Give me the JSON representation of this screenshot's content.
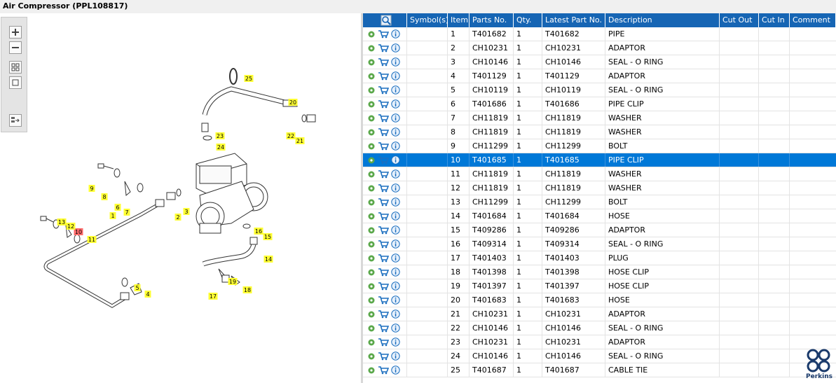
{
  "window": {
    "title": "Air Compressor (PPL108817)"
  },
  "toolbar": {
    "zoom_in_icon": "plus-icon",
    "zoom_out_icon": "minus-icon",
    "fit_icon": "grid-icon",
    "actual_icon": "square-icon",
    "export_icon": "list-arrow-icon"
  },
  "table": {
    "columns": [
      "",
      "Symbol(s)",
      "Item",
      "Parts No.",
      "Qty.",
      "Latest Part No.",
      "Description",
      "Cut Out",
      "Cut In",
      "Comment"
    ],
    "selected_item": "10",
    "rows": [
      {
        "item": "1",
        "part": "T401682",
        "qty": "1",
        "latest": "T401682",
        "desc": "PIPE"
      },
      {
        "item": "2",
        "part": "CH10231",
        "qty": "1",
        "latest": "CH10231",
        "desc": "ADAPTOR"
      },
      {
        "item": "3",
        "part": "CH10146",
        "qty": "1",
        "latest": "CH10146",
        "desc": "SEAL - O RING"
      },
      {
        "item": "4",
        "part": "T401129",
        "qty": "1",
        "latest": "T401129",
        "desc": "ADAPTOR"
      },
      {
        "item": "5",
        "part": "CH10119",
        "qty": "1",
        "latest": "CH10119",
        "desc": "SEAL - O RING"
      },
      {
        "item": "6",
        "part": "T401686",
        "qty": "1",
        "latest": "T401686",
        "desc": "PIPE CLIP"
      },
      {
        "item": "7",
        "part": "CH11819",
        "qty": "1",
        "latest": "CH11819",
        "desc": "WASHER"
      },
      {
        "item": "8",
        "part": "CH11819",
        "qty": "1",
        "latest": "CH11819",
        "desc": "WASHER"
      },
      {
        "item": "9",
        "part": "CH11299",
        "qty": "1",
        "latest": "CH11299",
        "desc": "BOLT"
      },
      {
        "item": "10",
        "part": "T401685",
        "qty": "1",
        "latest": "T401685",
        "desc": "PIPE CLIP"
      },
      {
        "item": "11",
        "part": "CH11819",
        "qty": "1",
        "latest": "CH11819",
        "desc": "WASHER"
      },
      {
        "item": "12",
        "part": "CH11819",
        "qty": "1",
        "latest": "CH11819",
        "desc": "WASHER"
      },
      {
        "item": "13",
        "part": "CH11299",
        "qty": "1",
        "latest": "CH11299",
        "desc": "BOLT"
      },
      {
        "item": "14",
        "part": "T401684",
        "qty": "1",
        "latest": "T401684",
        "desc": "HOSE"
      },
      {
        "item": "15",
        "part": "T409286",
        "qty": "1",
        "latest": "T409286",
        "desc": "ADAPTOR"
      },
      {
        "item": "16",
        "part": "T409314",
        "qty": "1",
        "latest": "T409314",
        "desc": "SEAL - O RING"
      },
      {
        "item": "17",
        "part": "T401403",
        "qty": "1",
        "latest": "T401403",
        "desc": "PLUG"
      },
      {
        "item": "18",
        "part": "T401398",
        "qty": "1",
        "latest": "T401398",
        "desc": "HOSE CLIP"
      },
      {
        "item": "19",
        "part": "T401397",
        "qty": "1",
        "latest": "T401397",
        "desc": "HOSE CLIP"
      },
      {
        "item": "20",
        "part": "T401683",
        "qty": "1",
        "latest": "T401683",
        "desc": "HOSE"
      },
      {
        "item": "21",
        "part": "CH10231",
        "qty": "1",
        "latest": "CH10231",
        "desc": "ADAPTOR"
      },
      {
        "item": "22",
        "part": "CH10146",
        "qty": "1",
        "latest": "CH10146",
        "desc": "SEAL - O RING"
      },
      {
        "item": "23",
        "part": "CH10231",
        "qty": "1",
        "latest": "CH10231",
        "desc": "ADAPTOR"
      },
      {
        "item": "24",
        "part": "CH10146",
        "qty": "1",
        "latest": "CH10146",
        "desc": "SEAL - O RING"
      },
      {
        "item": "25",
        "part": "T401687",
        "qty": "1",
        "latest": "T401687",
        "desc": "CABLE TIE"
      }
    ]
  },
  "diagram": {
    "callouts": [
      "1",
      "2",
      "3",
      "4",
      "5",
      "6",
      "7",
      "8",
      "9",
      "10",
      "11",
      "12",
      "13",
      "14",
      "15",
      "16",
      "17",
      "18",
      "19",
      "20",
      "21",
      "22",
      "23",
      "24",
      "25"
    ],
    "highlighted": "10"
  },
  "brand": {
    "name": "Perkins",
    "color": "#1a3a6b",
    "accent": "#1665b4",
    "selection": "#0078d7",
    "callout_bg": "#ffff33",
    "callout_sel": "#ff6a6a"
  }
}
